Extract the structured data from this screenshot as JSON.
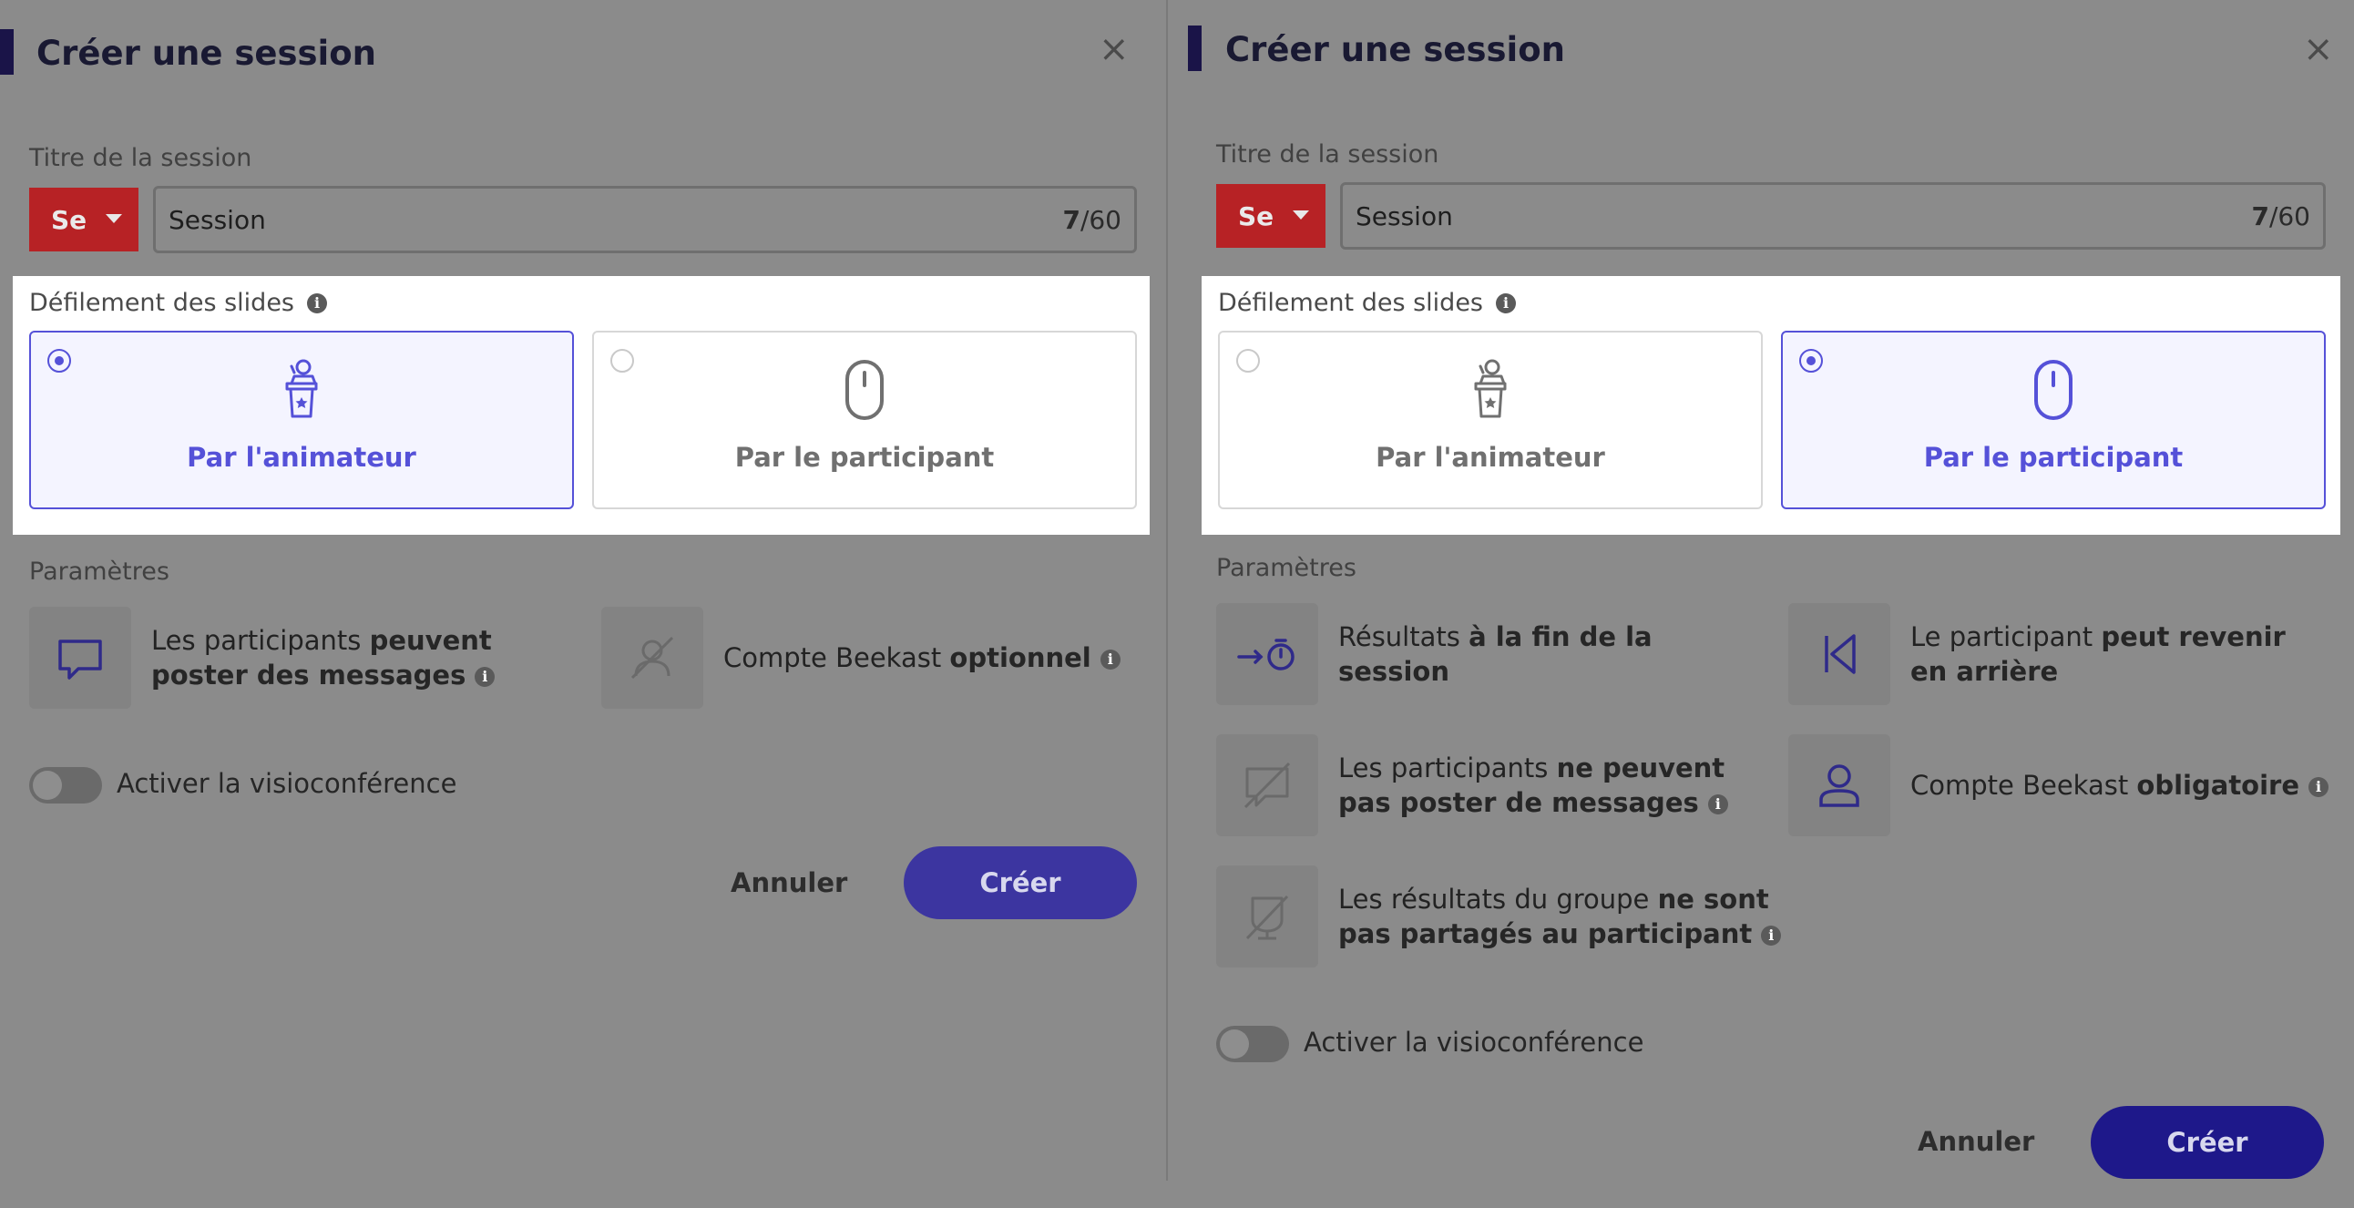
{
  "colors": {
    "accent": "#5551d8",
    "prefix_red": "#b72225",
    "create_button": "#3c35a0",
    "overlay": "#8b8b8b"
  },
  "left": {
    "title": "Créer une session",
    "close_icon": "×",
    "session_title_label": "Titre de la session",
    "prefix": "Se",
    "title_value": "Session",
    "count_current": "7",
    "count_max": "/60",
    "scroll_label": "Défilement des slides",
    "option_host": "Par l'animateur",
    "option_participant": "Par le participant",
    "selected": "host",
    "params_label": "Paramètres",
    "params": [
      {
        "icon": "message-icon",
        "pre": "Les participants ",
        "bold": "peuvent poster des messages",
        "post": "",
        "info": true
      },
      {
        "icon": "account-off-icon",
        "pre": "Compte Beekast ",
        "bold": "optionnel",
        "post": "",
        "info": true
      }
    ],
    "video_toggle_label": "Activer la visioconférence",
    "cancel": "Annuler",
    "create": "Créer"
  },
  "right": {
    "title": "Créer une session",
    "close_icon": "×",
    "session_title_label": "Titre de la session",
    "prefix": "Se",
    "title_value": "Session",
    "count_current": "7",
    "count_max": "/60",
    "scroll_label": "Défilement des slides",
    "option_host": "Par l'animateur",
    "option_participant": "Par le participant",
    "selected": "participant",
    "params_label": "Paramètres",
    "params": [
      {
        "icon": "results-timer-icon",
        "pre": "Résultats ",
        "bold": "à la fin de la session",
        "post": "",
        "info": false
      },
      {
        "icon": "back-icon",
        "pre": "Le participant ",
        "bold": "peut revenir en arrière",
        "post": "",
        "info": false
      },
      {
        "icon": "message-off-icon",
        "pre": "Les participants ",
        "bold": "ne peuvent pas poster de messages",
        "post": "",
        "info": true
      },
      {
        "icon": "user-icon",
        "pre": "Compte Beekast ",
        "bold": "obligatoire",
        "post": "",
        "info": true
      },
      {
        "icon": "results-off-icon",
        "pre": "Les résultats du groupe ",
        "bold": "ne sont pas partagés au participant",
        "post": "",
        "info": true
      }
    ],
    "video_toggle_label": "Activer la visioconférence",
    "cancel": "Annuler",
    "create": "Créer"
  }
}
